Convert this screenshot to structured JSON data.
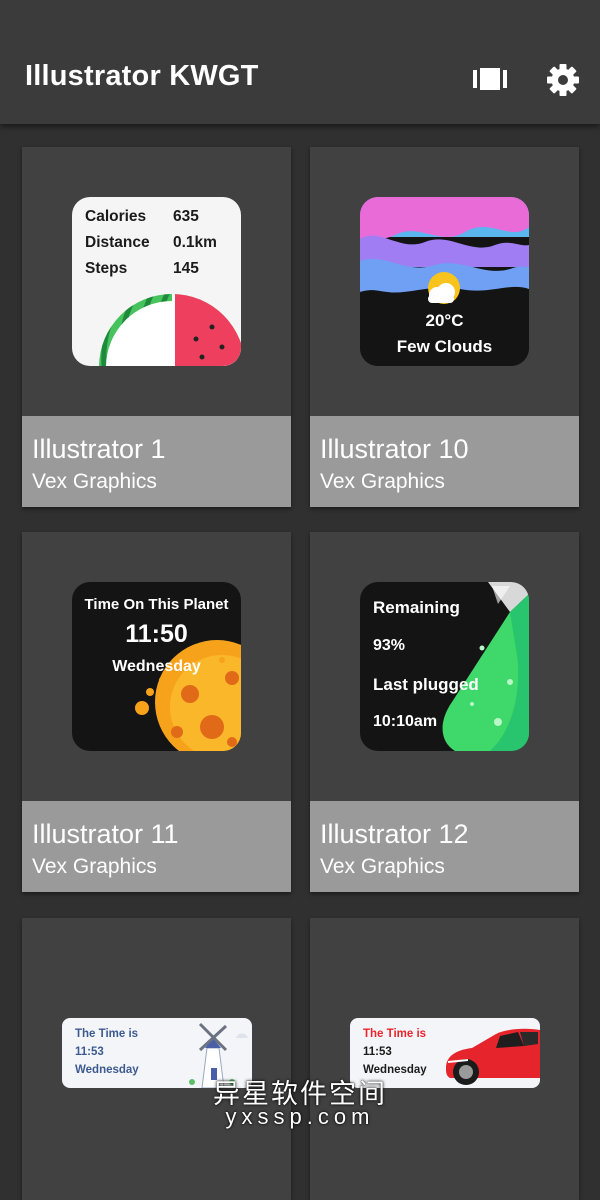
{
  "app": {
    "title": "Illustrator KWGT",
    "actions": [
      {
        "name": "view-toggle",
        "icon": "carousel-view-icon"
      },
      {
        "name": "settings",
        "icon": "gear-icon"
      }
    ]
  },
  "cards": [
    {
      "name": "Illustrator 1",
      "author": "Vex Graphics",
      "widget": {
        "rows": [
          {
            "label": "Calories",
            "value": "635"
          },
          {
            "label": "Distance",
            "value": "0.1km"
          },
          {
            "label": "Steps",
            "value": "145"
          }
        ],
        "art": "watermelon"
      }
    },
    {
      "name": "Illustrator 10",
      "author": "Vex Graphics",
      "widget": {
        "temperature": "20°C",
        "condition": "Few Clouds",
        "art": "partly-cloudy-icon"
      }
    },
    {
      "name": "Illustrator 11",
      "author": "Vex Graphics",
      "widget": {
        "heading": "Time On This Planet",
        "time": "11:50",
        "day": "Wednesday",
        "art": "planet"
      }
    },
    {
      "name": "Illustrator 12",
      "author": "Vex Graphics",
      "widget": {
        "remaining_label": "Remaining",
        "remaining_value": "93%",
        "plugged_label": "Last plugged",
        "plugged_value": "10:10am",
        "art": "flask"
      }
    },
    {
      "widget": {
        "line1": "The Time is",
        "line2": "11:53",
        "line3": "Wednesday",
        "art": "windmill"
      }
    },
    {
      "widget": {
        "line1": "The Time is",
        "line2": "11:53",
        "line3": "Wednesday",
        "art": "red-car"
      }
    }
  ],
  "watermark": {
    "text": "异星软件空间",
    "url": "yxssp.com"
  },
  "colors": {
    "background": "#303030",
    "appbar": "#3b3b3b",
    "card": "#414141",
    "card_footer": "#9a9a9a",
    "accent_red": "#e8262c",
    "text_blue": "#3d5a8f"
  }
}
